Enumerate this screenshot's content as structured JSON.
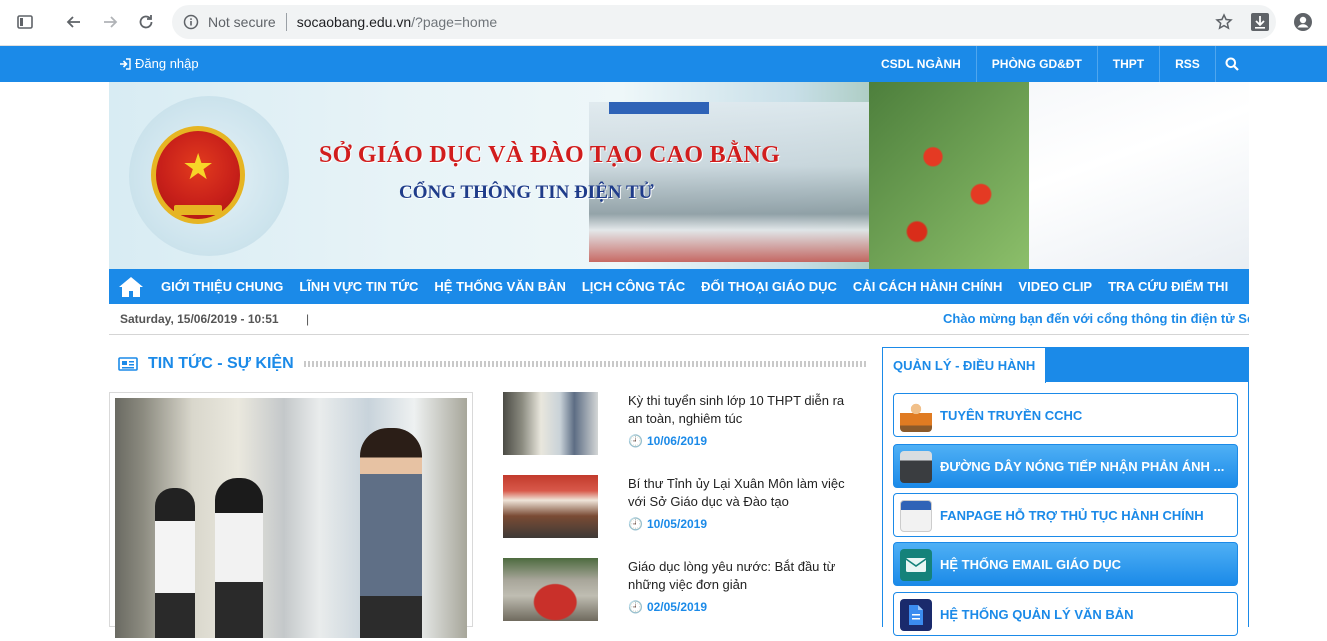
{
  "browser": {
    "security": "Not secure",
    "host": "socaobang.edu.vn",
    "path": "/?page=home"
  },
  "topbar": {
    "login": "Đăng nhập",
    "links": [
      "CSDL NGÀNH",
      "PHÒNG GD&ĐT",
      "THPT",
      "RSS"
    ]
  },
  "banner": {
    "title1": "SỞ GIÁO DỤC VÀ ĐÀO TẠO CAO BẰNG",
    "title2": "CỔNG THÔNG TIN ĐIỆN TỬ"
  },
  "nav": {
    "items": [
      "GIỚI THIỆU CHUNG",
      "LĨNH VỰC TIN TỨC",
      "HỆ THỐNG VĂN BẢN",
      "LỊCH CÔNG TÁC",
      "ĐỐI THOẠI GIÁO DỤC",
      "CẢI CÁCH HÀNH CHÍNH",
      "VIDEO CLIP",
      "TRA CỨU ĐIỂM THI"
    ]
  },
  "dateline": {
    "date": "Saturday, 15/06/2019 - 10:51",
    "pipe": "|",
    "marquee": "Chào mừng bạn đến với cổng thông tin điện tử Sở Giáo dục và Đào tạo Cao Bằng"
  },
  "news": {
    "section_title": "TIN TỨC - SỰ KIỆN",
    "items": [
      {
        "title": "Kỳ thi tuyển sinh lớp 10 THPT diễn ra an toàn, nghiêm túc",
        "date": "10/06/2019"
      },
      {
        "title": "Bí thư Tỉnh ủy Lại Xuân Môn làm việc với Sở Giáo dục và Đào tạo",
        "date": "10/05/2019"
      },
      {
        "title": "Giáo dục lòng yêu nước: Bắt đầu từ những việc đơn giản",
        "date": "02/05/2019"
      }
    ]
  },
  "sidebar": {
    "tab": "QUẢN LÝ - ĐIỀU HÀNH",
    "buttons": [
      {
        "label": "TUYÊN TRUYỀN CCHC",
        "icon": "worker-icon"
      },
      {
        "label": "ĐƯỜNG DÂY NÓNG TIẾP NHẬN PHẢN ÁNH ...",
        "icon": "fax-icon"
      },
      {
        "label": "FANPAGE HỖ TRỢ THỦ TỤC HÀNH CHÍNH",
        "icon": "fanpage-icon"
      },
      {
        "label": "HỆ THỐNG EMAIL GIÁO DỤC",
        "icon": "email-icon"
      },
      {
        "label": "HỆ THỐNG QUẢN LÝ VĂN BẢN",
        "icon": "document-icon"
      }
    ]
  },
  "colors": {
    "primary": "#1b8ae8",
    "title_red": "#d11d1d",
    "title_navy": "#1f3c8a"
  }
}
